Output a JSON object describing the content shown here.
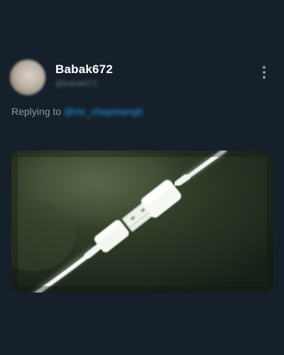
{
  "tweet": {
    "author": {
      "display_name": "Babak672",
      "handle": "@babak672"
    },
    "reply": {
      "prefix": "Replying to",
      "mention": "@mr_chapmangh"
    },
    "more_icon": "more-vertical-icon",
    "media": {
      "kind": "photo",
      "subject": "usb-cable-photo"
    }
  },
  "colors": {
    "background": "#15202b",
    "primary_text": "#ffffff",
    "secondary_text": "#8899a6",
    "link": "#1d9bf0"
  }
}
